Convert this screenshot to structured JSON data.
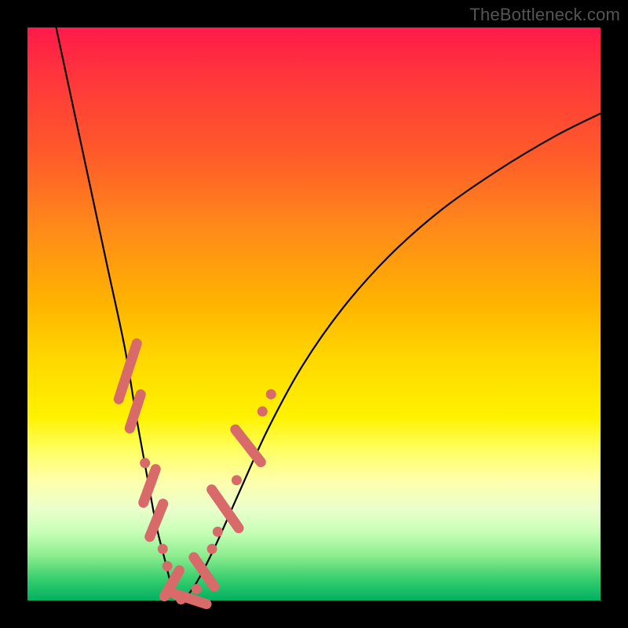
{
  "watermark": "TheBottleneck.com",
  "chart_data": {
    "type": "line",
    "title": "",
    "xlabel": "",
    "ylabel": "",
    "xlim": [
      0,
      100
    ],
    "ylim": [
      0,
      100
    ],
    "gradient_stops": [
      {
        "pos": 0,
        "color": "#ff1a4a"
      },
      {
        "pos": 10,
        "color": "#ff3a3a"
      },
      {
        "pos": 22,
        "color": "#ff5a2a"
      },
      {
        "pos": 35,
        "color": "#ff8a1a"
      },
      {
        "pos": 48,
        "color": "#ffb300"
      },
      {
        "pos": 58,
        "color": "#ffd800"
      },
      {
        "pos": 68,
        "color": "#fff200"
      },
      {
        "pos": 74,
        "color": "#ffff66"
      },
      {
        "pos": 79,
        "color": "#ffffaa"
      },
      {
        "pos": 84,
        "color": "#eaffcc"
      },
      {
        "pos": 88,
        "color": "#c8ffb8"
      },
      {
        "pos": 92,
        "color": "#90ee90"
      },
      {
        "pos": 96,
        "color": "#3cd070"
      },
      {
        "pos": 100,
        "color": "#00b060"
      }
    ],
    "series": [
      {
        "name": "left-curve",
        "x": [
          5,
          8,
          11,
          14,
          17,
          19,
          21,
          22.5,
          24,
          25,
          25.8,
          26.5
        ],
        "y": [
          100,
          86,
          72,
          58,
          44,
          32,
          21,
          13,
          7,
          3,
          1,
          0
        ]
      },
      {
        "name": "right-curve",
        "x": [
          26.5,
          28,
          30,
          33,
          37,
          42,
          48,
          55,
          63,
          72,
          82,
          92,
          100
        ],
        "y": [
          0,
          1,
          4,
          10,
          19,
          30,
          41,
          51,
          60,
          68,
          75,
          81,
          85
        ]
      }
    ],
    "markers": [
      {
        "x": 17.5,
        "y": 40,
        "kind": "pill",
        "len": 12,
        "angle": -72
      },
      {
        "x": 18.8,
        "y": 33,
        "kind": "pill",
        "len": 8,
        "angle": -72
      },
      {
        "x": 20.5,
        "y": 24,
        "kind": "dot"
      },
      {
        "x": 21.3,
        "y": 20,
        "kind": "pill",
        "len": 8,
        "angle": -70
      },
      {
        "x": 22.5,
        "y": 14,
        "kind": "pill",
        "len": 8,
        "angle": -68
      },
      {
        "x": 23.6,
        "y": 9,
        "kind": "dot"
      },
      {
        "x": 24.4,
        "y": 6,
        "kind": "dot"
      },
      {
        "x": 25.2,
        "y": 3,
        "kind": "pill",
        "len": 7,
        "angle": -60
      },
      {
        "x": 26.0,
        "y": 1,
        "kind": "dot"
      },
      {
        "x": 26.8,
        "y": 0.2,
        "kind": "dot"
      },
      {
        "x": 27.8,
        "y": 0.5,
        "kind": "pill",
        "len": 9,
        "angle": 18
      },
      {
        "x": 29.5,
        "y": 2,
        "kind": "dot"
      },
      {
        "x": 30.8,
        "y": 5,
        "kind": "pill",
        "len": 8,
        "angle": 55
      },
      {
        "x": 32.2,
        "y": 9,
        "kind": "dot"
      },
      {
        "x": 33.2,
        "y": 12,
        "kind": "dot"
      },
      {
        "x": 34.5,
        "y": 16,
        "kind": "pill",
        "len": 10,
        "angle": 55
      },
      {
        "x": 36.5,
        "y": 21,
        "kind": "dot"
      },
      {
        "x": 38.5,
        "y": 27,
        "kind": "pill",
        "len": 9,
        "angle": 52
      },
      {
        "x": 41.0,
        "y": 33,
        "kind": "dot"
      },
      {
        "x": 42.5,
        "y": 36,
        "kind": "dot"
      }
    ]
  }
}
